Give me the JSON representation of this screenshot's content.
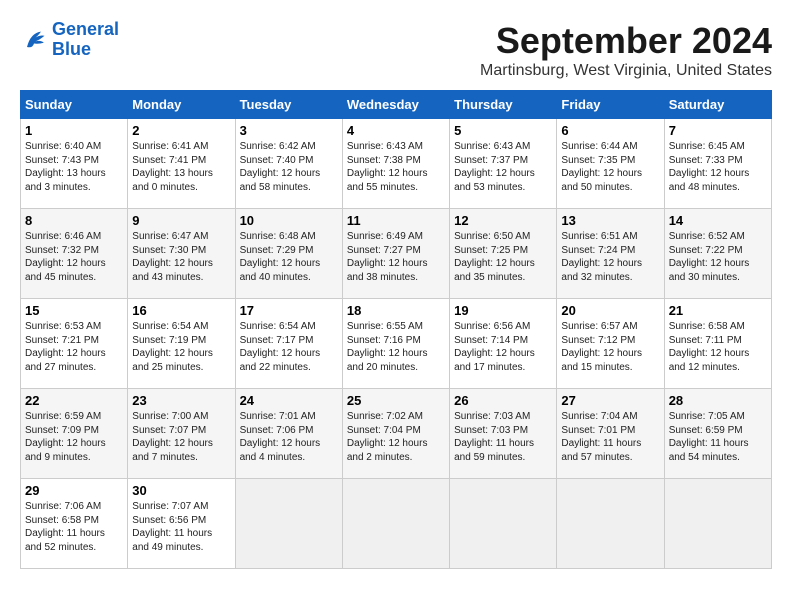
{
  "header": {
    "logo_line1": "General",
    "logo_line2": "Blue",
    "month": "September 2024",
    "location": "Martinsburg, West Virginia, United States"
  },
  "columns": [
    "Sunday",
    "Monday",
    "Tuesday",
    "Wednesday",
    "Thursday",
    "Friday",
    "Saturday"
  ],
  "weeks": [
    [
      {
        "day": 1,
        "sunrise": "6:40 AM",
        "sunset": "7:43 PM",
        "daylight": "13 hours and 3 minutes."
      },
      {
        "day": 2,
        "sunrise": "6:41 AM",
        "sunset": "7:41 PM",
        "daylight": "13 hours and 0 minutes."
      },
      {
        "day": 3,
        "sunrise": "6:42 AM",
        "sunset": "7:40 PM",
        "daylight": "12 hours and 58 minutes."
      },
      {
        "day": 4,
        "sunrise": "6:43 AM",
        "sunset": "7:38 PM",
        "daylight": "12 hours and 55 minutes."
      },
      {
        "day": 5,
        "sunrise": "6:43 AM",
        "sunset": "7:37 PM",
        "daylight": "12 hours and 53 minutes."
      },
      {
        "day": 6,
        "sunrise": "6:44 AM",
        "sunset": "7:35 PM",
        "daylight": "12 hours and 50 minutes."
      },
      {
        "day": 7,
        "sunrise": "6:45 AM",
        "sunset": "7:33 PM",
        "daylight": "12 hours and 48 minutes."
      }
    ],
    [
      {
        "day": 8,
        "sunrise": "6:46 AM",
        "sunset": "7:32 PM",
        "daylight": "12 hours and 45 minutes."
      },
      {
        "day": 9,
        "sunrise": "6:47 AM",
        "sunset": "7:30 PM",
        "daylight": "12 hours and 43 minutes."
      },
      {
        "day": 10,
        "sunrise": "6:48 AM",
        "sunset": "7:29 PM",
        "daylight": "12 hours and 40 minutes."
      },
      {
        "day": 11,
        "sunrise": "6:49 AM",
        "sunset": "7:27 PM",
        "daylight": "12 hours and 38 minutes."
      },
      {
        "day": 12,
        "sunrise": "6:50 AM",
        "sunset": "7:25 PM",
        "daylight": "12 hours and 35 minutes."
      },
      {
        "day": 13,
        "sunrise": "6:51 AM",
        "sunset": "7:24 PM",
        "daylight": "12 hours and 32 minutes."
      },
      {
        "day": 14,
        "sunrise": "6:52 AM",
        "sunset": "7:22 PM",
        "daylight": "12 hours and 30 minutes."
      }
    ],
    [
      {
        "day": 15,
        "sunrise": "6:53 AM",
        "sunset": "7:21 PM",
        "daylight": "12 hours and 27 minutes."
      },
      {
        "day": 16,
        "sunrise": "6:54 AM",
        "sunset": "7:19 PM",
        "daylight": "12 hours and 25 minutes."
      },
      {
        "day": 17,
        "sunrise": "6:54 AM",
        "sunset": "7:17 PM",
        "daylight": "12 hours and 22 minutes."
      },
      {
        "day": 18,
        "sunrise": "6:55 AM",
        "sunset": "7:16 PM",
        "daylight": "12 hours and 20 minutes."
      },
      {
        "day": 19,
        "sunrise": "6:56 AM",
        "sunset": "7:14 PM",
        "daylight": "12 hours and 17 minutes."
      },
      {
        "day": 20,
        "sunrise": "6:57 AM",
        "sunset": "7:12 PM",
        "daylight": "12 hours and 15 minutes."
      },
      {
        "day": 21,
        "sunrise": "6:58 AM",
        "sunset": "7:11 PM",
        "daylight": "12 hours and 12 minutes."
      }
    ],
    [
      {
        "day": 22,
        "sunrise": "6:59 AM",
        "sunset": "7:09 PM",
        "daylight": "12 hours and 9 minutes."
      },
      {
        "day": 23,
        "sunrise": "7:00 AM",
        "sunset": "7:07 PM",
        "daylight": "12 hours and 7 minutes."
      },
      {
        "day": 24,
        "sunrise": "7:01 AM",
        "sunset": "7:06 PM",
        "daylight": "12 hours and 4 minutes."
      },
      {
        "day": 25,
        "sunrise": "7:02 AM",
        "sunset": "7:04 PM",
        "daylight": "12 hours and 2 minutes."
      },
      {
        "day": 26,
        "sunrise": "7:03 AM",
        "sunset": "7:03 PM",
        "daylight": "11 hours and 59 minutes."
      },
      {
        "day": 27,
        "sunrise": "7:04 AM",
        "sunset": "7:01 PM",
        "daylight": "11 hours and 57 minutes."
      },
      {
        "day": 28,
        "sunrise": "7:05 AM",
        "sunset": "6:59 PM",
        "daylight": "11 hours and 54 minutes."
      }
    ],
    [
      {
        "day": 29,
        "sunrise": "7:06 AM",
        "sunset": "6:58 PM",
        "daylight": "11 hours and 52 minutes."
      },
      {
        "day": 30,
        "sunrise": "7:07 AM",
        "sunset": "6:56 PM",
        "daylight": "11 hours and 49 minutes."
      },
      null,
      null,
      null,
      null,
      null
    ]
  ]
}
